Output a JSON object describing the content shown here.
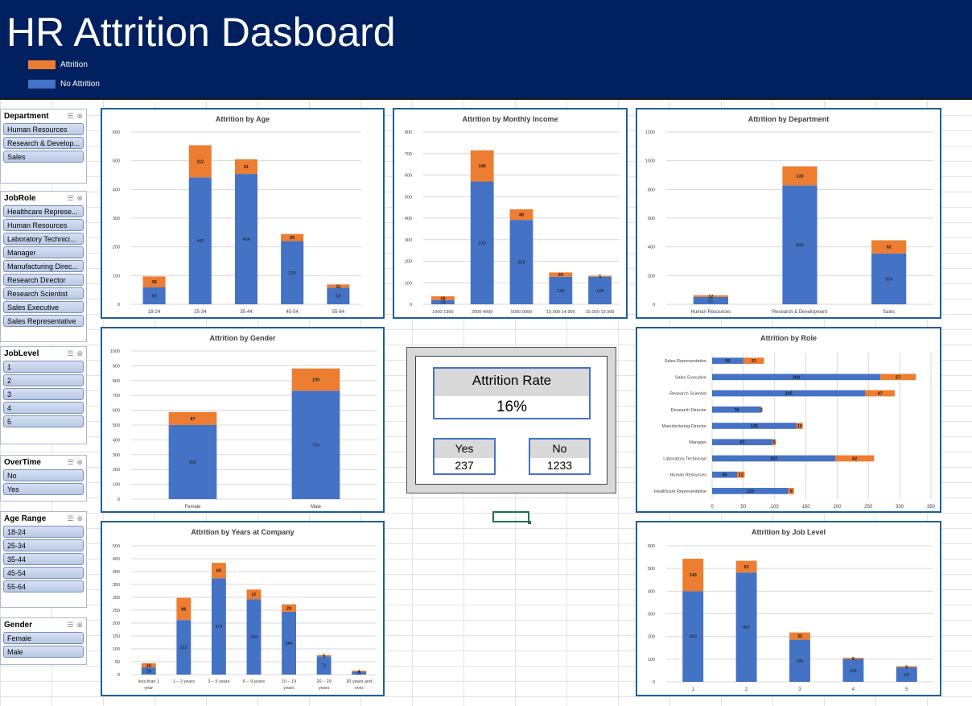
{
  "header": {
    "title": "HR Attrition Dasboard",
    "legend": {
      "attrition": "Attrition",
      "no_attrition": "No Attrition"
    }
  },
  "colors": {
    "attrition": "#ed7d31",
    "no_attrition": "#4472c4",
    "header_bg": "#002060",
    "chart_border": "#1f5f99"
  },
  "slicers": [
    {
      "title": "Department",
      "items": [
        "Human Resources",
        "Research & Develop...",
        "Sales"
      ]
    },
    {
      "title": "JobRole",
      "items": [
        "Healthcare Represe...",
        "Human Resources",
        "Laboratory Technici...",
        "Manager",
        "Manufacturing Direc...",
        "Research Director",
        "Research Scientist",
        "Sales Executive",
        "Sales Representative"
      ]
    },
    {
      "title": "JobLevel",
      "items": [
        "1",
        "2",
        "3",
        "4",
        "5"
      ]
    },
    {
      "title": "OverTime",
      "items": [
        "No",
        "Yes"
      ]
    },
    {
      "title": "Age Range",
      "items": [
        "18-24",
        "25-34",
        "35-44",
        "45-54",
        "55-64"
      ]
    },
    {
      "title": "Gender",
      "items": [
        "Female",
        "Male"
      ]
    }
  ],
  "kpi": {
    "title": "Attrition Rate",
    "value": "16%",
    "yes_label": "Yes",
    "yes_value": "237",
    "no_label": "No",
    "no_value": "1233"
  },
  "chart_data": [
    {
      "id": "age",
      "type": "bar",
      "stacked": true,
      "title": "Attrition by Age",
      "categories": [
        "18-24",
        "25-34",
        "35-44",
        "45-54",
        "55-64"
      ],
      "series": [
        {
          "name": "No Attrition",
          "values": [
            59,
            442,
            454,
            220,
            58
          ]
        },
        {
          "name": "Attrition",
          "values": [
            38,
            112,
            51,
            25,
            11
          ]
        }
      ],
      "ylim": [
        0,
        600
      ],
      "yticks": [
        0,
        100,
        200,
        300,
        400,
        500,
        600
      ]
    },
    {
      "id": "income",
      "type": "bar",
      "stacked": true,
      "title": "Attrition by Monthly Income",
      "categories": [
        "1000-1999",
        "2000-4999",
        "5000-9999",
        "10,000-14,999",
        "15,000-19,999"
      ],
      "series": [
        {
          "name": "No Attrition",
          "values": [
            19,
            570,
            392,
            128,
            128
          ]
        },
        {
          "name": "Attrition",
          "values": [
            18,
            145,
            49,
            20,
            5
          ]
        }
      ],
      "ylim": [
        0,
        800
      ],
      "yticks": [
        0,
        100,
        200,
        300,
        400,
        500,
        600,
        700,
        800
      ]
    },
    {
      "id": "dept",
      "type": "bar",
      "stacked": true,
      "title": "Attrition by Department",
      "categories": [
        "Human Resources",
        "Research & Development",
        "Sales"
      ],
      "series": [
        {
          "name": "No Attrition",
          "values": [
            51,
            828,
            354
          ]
        },
        {
          "name": "Attrition",
          "values": [
            12,
            133,
            92
          ]
        }
      ],
      "ylim": [
        0,
        1200
      ],
      "yticks": [
        0,
        200,
        400,
        600,
        800,
        1000,
        1200
      ]
    },
    {
      "id": "gender",
      "type": "bar",
      "stacked": true,
      "title": "Attrition by Gender",
      "categories": [
        "Female",
        "Male"
      ],
      "series": [
        {
          "name": "No Attrition",
          "values": [
            501,
            732
          ]
        },
        {
          "name": "Attrition",
          "values": [
            87,
            150
          ]
        }
      ],
      "data_labels": [
        [
          "500",
          "733"
        ],
        [
          "87",
          "150"
        ]
      ],
      "ylim": [
        0,
        1000
      ],
      "yticks": [
        0,
        100,
        200,
        300,
        400,
        500,
        600,
        700,
        800,
        900,
        1000
      ]
    },
    {
      "id": "role",
      "type": "bar",
      "orientation": "horizontal",
      "stacked": true,
      "title": "Attrition by Role",
      "categories": [
        "Sales Representative",
        "Sales Executive",
        "Research Scientist",
        "Research Director",
        "Manufacturing Director",
        "Manager",
        "Laboratory Technician",
        "Human Resources",
        "Healthcare Representative"
      ],
      "series": [
        {
          "name": "No Attrition",
          "values": [
            50,
            269,
            245,
            78,
            135,
            97,
            197,
            40,
            122
          ]
        },
        {
          "name": "Attrition",
          "values": [
            33,
            57,
            47,
            2,
            10,
            5,
            62,
            12,
            9
          ]
        }
      ],
      "xlim": [
        0,
        350
      ],
      "xticks": [
        0,
        50,
        100,
        150,
        200,
        250,
        300,
        350
      ]
    },
    {
      "id": "years",
      "type": "bar",
      "stacked": true,
      "title": "Attrition by Years at Company",
      "categories": [
        "less than 1 year",
        "1 – 2 years",
        "3 – 5 years",
        "6 – 9 years",
        "10 – 19 years",
        "20 – 29 years",
        "30 years and over"
      ],
      "series": [
        {
          "name": "No Attrition",
          "values": [
            28,
            212,
            374,
            293,
            244,
            71,
            11
          ]
        },
        {
          "name": "Attrition",
          "values": [
            16,
            86,
            60,
            37,
            29,
            5,
            4
          ]
        }
      ],
      "ylim": [
        0,
        500
      ],
      "yticks": [
        0,
        50,
        100,
        150,
        200,
        250,
        300,
        350,
        400,
        450,
        500
      ]
    },
    {
      "id": "level",
      "type": "bar",
      "stacked": true,
      "title": "Attrition by Job Level",
      "categories": [
        "1",
        "2",
        "3",
        "4",
        "5"
      ],
      "series": [
        {
          "name": "No Attrition",
          "values": [
            400,
            482,
            186,
            101,
            64
          ]
        },
        {
          "name": "Attrition",
          "values": [
            143,
            52,
            32,
            5,
            5
          ]
        }
      ],
      "ylim": [
        0,
        600
      ],
      "yticks": [
        0,
        100,
        200,
        300,
        400,
        500,
        600
      ]
    }
  ]
}
